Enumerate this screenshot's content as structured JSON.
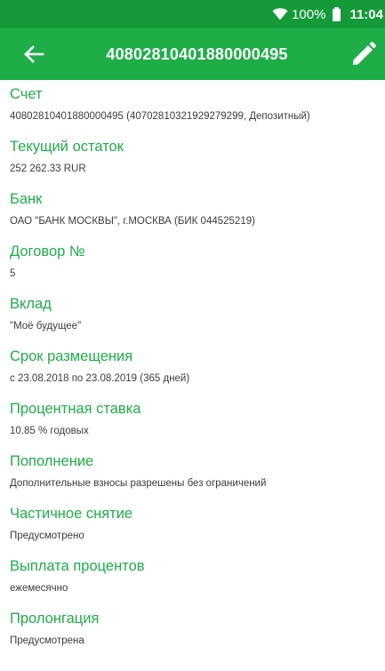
{
  "status_bar": {
    "battery_text": "100%",
    "time": "11:04"
  },
  "toolbar": {
    "title": "40802810401880000495"
  },
  "fields": [
    {
      "label": "Счет",
      "value": "40802810401880000495 (40702810321929279299, Депозитный)"
    },
    {
      "label": "Текущий остаток",
      "value": "252 262.33 RUR"
    },
    {
      "label": "Банк",
      "value": "ОАО \"БАНК МОСКВЫ\", г.МОСКВА (БИК 044525219)"
    },
    {
      "label": "Договор №",
      "value": "5"
    },
    {
      "label": "Вклад",
      "value": "\"Моё будущее\""
    },
    {
      "label": "Срок размещения",
      "value": "с 23.08.2018 по 23.08.2019 (365 дней)"
    },
    {
      "label": "Процентная ставка",
      "value": "10.85 % годовых"
    },
    {
      "label": "Пополнение",
      "value": "Дополнительные взносы разрешены без ограничений"
    },
    {
      "label": "Частичное снятие",
      "value": "Предусмотрено"
    },
    {
      "label": "Выплата процентов",
      "value": "ежемесячно"
    },
    {
      "label": "Пролонгация",
      "value": "Предусмотрена"
    }
  ],
  "icons": {
    "back": "arrow-back-icon",
    "edit": "pencil-icon",
    "wifi": "wifi-icon",
    "battery": "battery-icon"
  },
  "colors": {
    "status_bar": "#159a3a",
    "toolbar": "#1fad48",
    "label": "#1fad48",
    "value": "#3c3c3c"
  }
}
